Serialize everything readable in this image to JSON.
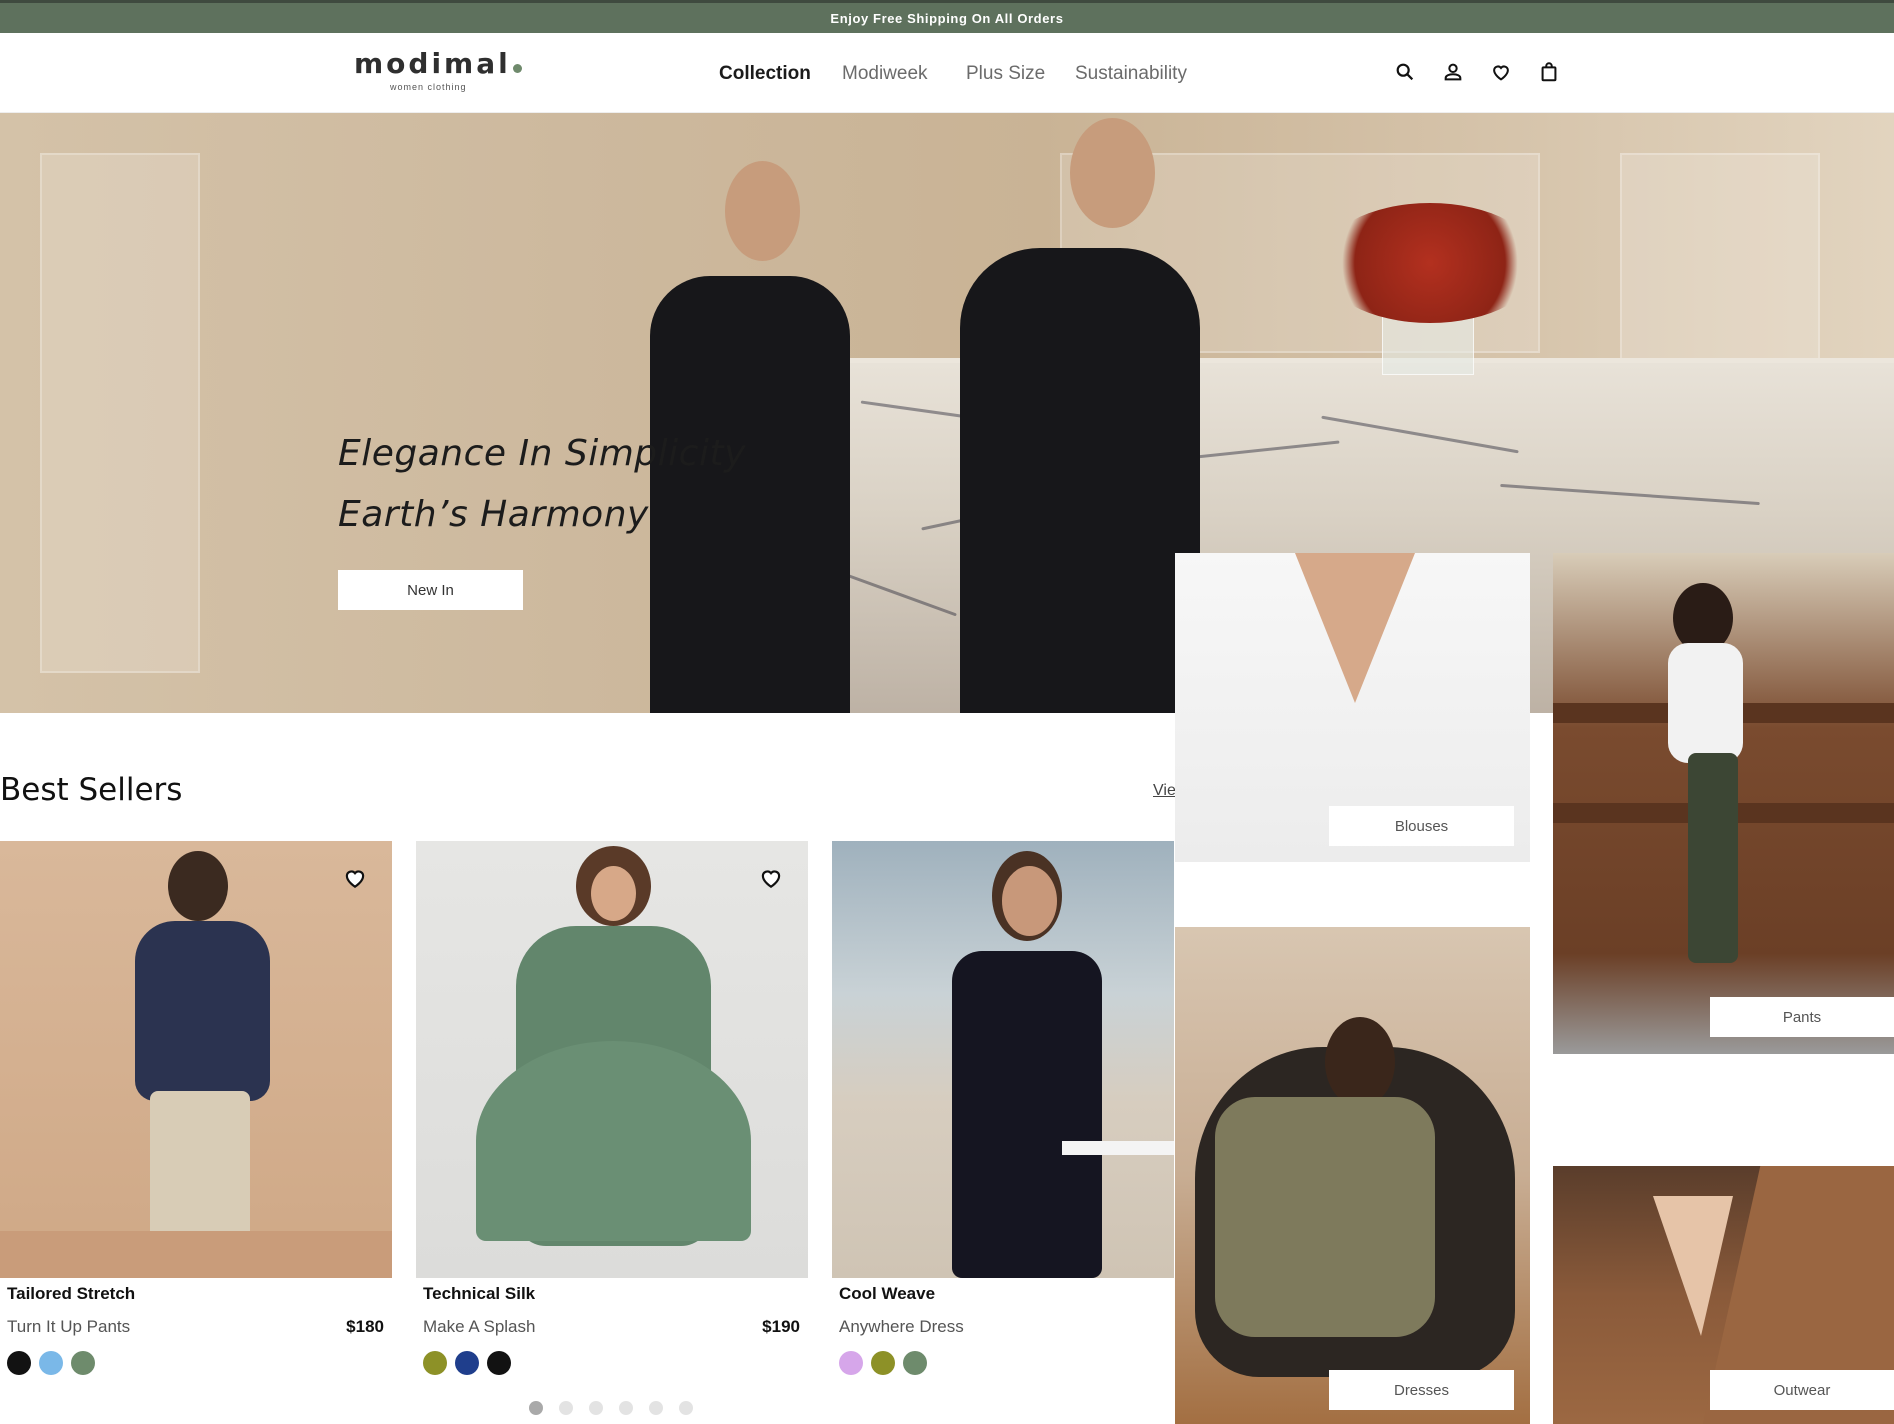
{
  "promo": {
    "text": "Enjoy Free Shipping On All Orders"
  },
  "brand": {
    "name": "modimal",
    "tagline": "women clothing",
    "accent": "#5e715d"
  },
  "nav": {
    "items": [
      {
        "label": "Collection",
        "active": true
      },
      {
        "label": "Modiweek"
      },
      {
        "label": "Plus Size"
      },
      {
        "label": "Sustainability"
      }
    ]
  },
  "header_icons": [
    "search-icon",
    "user-icon",
    "heart-icon",
    "bag-icon"
  ],
  "hero": {
    "line1": "Elegance In Simplicity",
    "line2": "Earth’s Harmony",
    "cta": "New In"
  },
  "best_sellers": {
    "title": "Best Sellers",
    "view_all": "View All",
    "products": [
      {
        "name": "Tailored Stretch",
        "subtitle": "Turn It Up Pants",
        "price": "$180",
        "swatches": [
          "#121212",
          "#7ab8e8",
          "#6e8b6c"
        ]
      },
      {
        "name": "Technical Silk",
        "subtitle": "Make A Splash",
        "price": "$190",
        "swatches": [
          "#8d9127",
          "#1f3e8c",
          "#121212"
        ]
      },
      {
        "name": "Cool Weave",
        "subtitle": "Anywhere Dress",
        "price": "",
        "swatches": [
          "#d6a6ea",
          "#8d9127",
          "#6e8b6c"
        ]
      }
    ],
    "pager": {
      "count": 6,
      "active": 1
    }
  },
  "categories": [
    {
      "label": "Blouses"
    },
    {
      "label": "Pants"
    },
    {
      "label": "Dresses"
    },
    {
      "label": "Outwear"
    }
  ]
}
